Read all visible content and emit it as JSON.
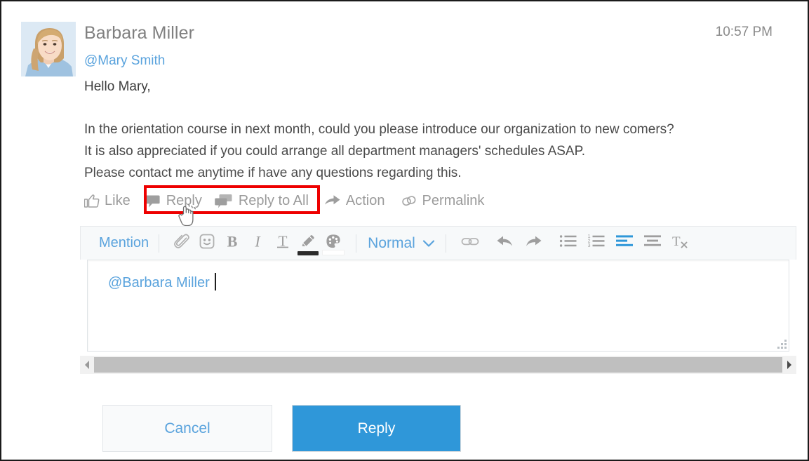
{
  "post": {
    "author": "Barbara Miller",
    "timestamp": "10:57 PM",
    "mention_to": "@Mary Smith",
    "greeting": "Hello Mary,",
    "body": "In the orientation course in next month, could you please introduce our organization to new comers?\nIt is also appreciated if you could arrange all department managers' schedules ASAP.\nPlease contact me anytime if have any questions regarding this.",
    "avatar_name": "avatar-barbara-miller"
  },
  "actions": {
    "like": "Like",
    "reply": "Reply",
    "reply_all": "Reply to All",
    "action": "Action",
    "permalink": "Permalink",
    "icons": {
      "like": "thumbs-up-icon",
      "reply": "speech-bubble-icon",
      "reply_all": "double-speech-bubble-icon",
      "action": "arrow-forward-icon",
      "permalink": "link-chain-icon"
    },
    "highlight_color": "#ee0000"
  },
  "editor": {
    "mention_label": "Mention",
    "format_label": "Normal",
    "content": "@Barbara Miller",
    "toolbar_icons": [
      "paperclip-icon",
      "emoji-smiley-icon",
      "bold-icon",
      "italic-icon",
      "underline-text-icon",
      "pencil-icon",
      "color-palette-icon",
      "chevron-down-icon",
      "link-icon",
      "undo-arrow-icon",
      "redo-arrow-icon",
      "bulleted-list-icon",
      "numbered-list-icon",
      "align-left-icon",
      "align-center-icon",
      "clear-formatting-icon"
    ],
    "active_accent": "#2f97d9",
    "pen_swatch": "#2b2b2b",
    "palette_swatch": "#ffffff",
    "scrollbar": {
      "left_arrow": "scroll-left-arrow-icon",
      "right_arrow": "scroll-right-arrow-icon"
    }
  },
  "footer": {
    "cancel_label": "Cancel",
    "reply_label": "Reply",
    "primary_color": "#2f97d9"
  }
}
